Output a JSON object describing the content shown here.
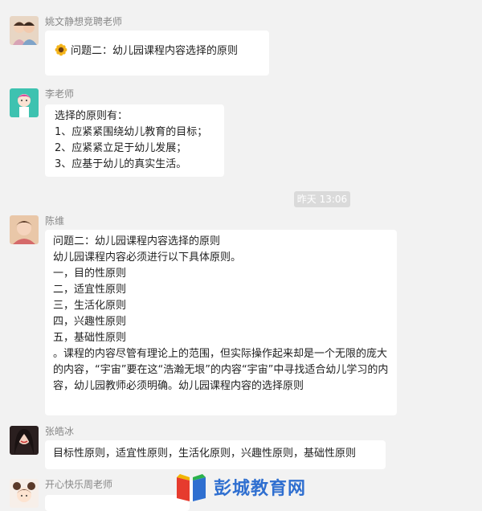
{
  "messages": [
    {
      "sender": "姚文静想竞聘老师",
      "lines": [
        "问题二：幼儿园课程内容选择的原则"
      ],
      "icon": "sunflower-icon"
    },
    {
      "sender": "李老师",
      "lines": [
        "选择的原则有：",
        "1、应紧紧围绕幼儿教育的目标；",
        "2、应紧紧立足于幼儿发展；",
        "3、应基于幼儿的真实生活。"
      ]
    },
    {
      "sender": "陈维",
      "lines": [
        "问题二：幼儿园课程内容选择的原则",
        "幼儿园课程内容必须进行以下具体原则。",
        "一，目的性原则",
        "二，适宜性原则",
        "三，生活化原则",
        "四，兴趣性原则",
        "五，基础性原则"
      ],
      "paragraph": "。课程的内容尽管有理论上的范围，但实际操作起来却是一个无限的庞大的内容，“宇宙”要在这“浩瀚无垠”的内容“宇宙”中寻找适合幼儿学习的内容，幼儿园教师必须明确。幼儿园课程内容的选择原则"
    },
    {
      "sender": "张皓冰",
      "lines": [
        "目标性原则，适宜性原则，生活化原则，兴趣性原则，基础性原则"
      ]
    },
    {
      "sender": "开心快乐周老师",
      "lines": []
    }
  ],
  "timestamp": "昨天 13:06",
  "watermark": {
    "text": "彭城教育网",
    "logo": "book-logo-icon"
  }
}
